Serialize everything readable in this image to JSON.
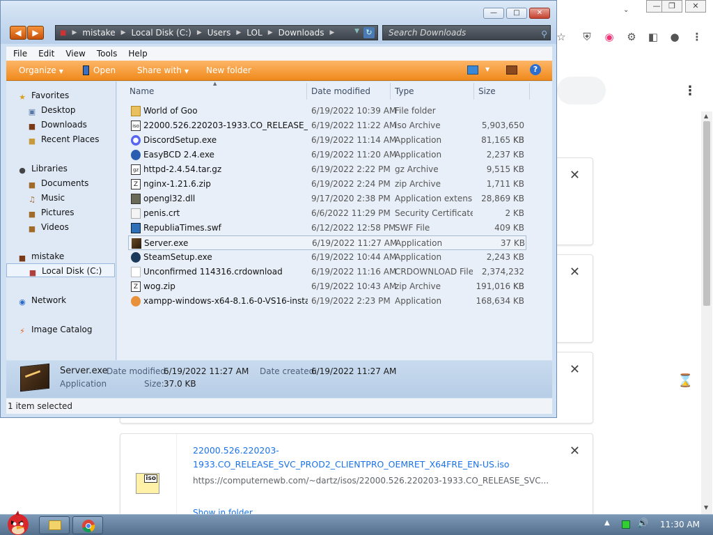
{
  "explorer": {
    "address": [
      "mistake",
      "Local Disk (C:)",
      "Users",
      "LOL",
      "Downloads"
    ],
    "search_placeholder": "Search Downloads",
    "menu": [
      "File",
      "Edit",
      "View",
      "Tools",
      "Help"
    ],
    "commands": {
      "organize": "Organize",
      "open": "Open",
      "share_with": "Share with",
      "new_folder": "New folder"
    },
    "nav": {
      "favorites": "Favorites",
      "favorites_items": [
        "Desktop",
        "Downloads",
        "Recent Places"
      ],
      "libraries": "Libraries",
      "libraries_items": [
        "Documents",
        "Music",
        "Pictures",
        "Videos"
      ],
      "computer": "mistake",
      "computer_items": [
        "Local Disk (C:)"
      ],
      "network": "Network",
      "image_catalog": "Image Catalog"
    },
    "columns": {
      "name": "Name",
      "date": "Date modified",
      "type": "Type",
      "size": "Size"
    },
    "files": [
      {
        "name": "World of Goo",
        "date": "6/19/2022 10:39 AM",
        "type": "File folder",
        "size": "",
        "icon": "folder-icon"
      },
      {
        "name": "22000.526.220203-1933.CO_RELEASE_SVC...",
        "date": "6/19/2022 11:22 AM",
        "type": "iso Archive",
        "size": "5,903,650 KB",
        "icon": "iso-icon"
      },
      {
        "name": "DiscordSetup.exe",
        "date": "6/19/2022 11:14 AM",
        "type": "Application",
        "size": "81,165 KB",
        "icon": "discord-icon"
      },
      {
        "name": "EasyBCD 2.4.exe",
        "date": "6/19/2022 11:20 AM",
        "type": "Application",
        "size": "2,237 KB",
        "icon": "app-icon"
      },
      {
        "name": "httpd-2.4.54.tar.gz",
        "date": "6/19/2022 2:22 PM",
        "type": "gz Archive",
        "size": "9,515 KB",
        "icon": "archive-icon"
      },
      {
        "name": "nginx-1.21.6.zip",
        "date": "6/19/2022 2:24 PM",
        "type": "zip Archive",
        "size": "1,711 KB",
        "icon": "zip-icon"
      },
      {
        "name": "opengl32.dll",
        "date": "9/17/2020 2:38 PM",
        "type": "Application extens...",
        "size": "28,869 KB",
        "icon": "dll-icon"
      },
      {
        "name": "penis.crt",
        "date": "6/6/2022 11:29 PM",
        "type": "Security Certificate",
        "size": "2 KB",
        "icon": "certificate-icon"
      },
      {
        "name": "RepubliaTimes.swf",
        "date": "6/12/2022 12:58 PM",
        "type": "SWF File",
        "size": "409 KB",
        "icon": "swf-icon"
      },
      {
        "name": "Server.exe",
        "date": "6/19/2022 11:27 AM",
        "type": "Application",
        "size": "37 KB",
        "icon": "server-exe-icon"
      },
      {
        "name": "SteamSetup.exe",
        "date": "6/19/2022 10:44 AM",
        "type": "Application",
        "size": "2,243 KB",
        "icon": "steam-icon"
      },
      {
        "name": "Unconfirmed 114316.crdownload",
        "date": "6/19/2022 11:16 AM",
        "type": "CRDOWNLOAD File",
        "size": "2,374,232 KB",
        "icon": "file-icon"
      },
      {
        "name": "wog.zip",
        "date": "6/19/2022 10:43 AM",
        "type": "zip Archive",
        "size": "191,016 KB",
        "icon": "zip-icon"
      },
      {
        "name": "xampp-windows-x64-8.1.6-0-VS16-install...",
        "date": "6/19/2022 2:23 PM",
        "type": "Application",
        "size": "168,634 KB",
        "icon": "xampp-icon"
      }
    ],
    "details": {
      "name": "Server.exe",
      "type": "Application",
      "date_modified_label": "Date modified:",
      "date_modified": "6/19/2022 11:27 AM",
      "date_created_label": "Date created:",
      "date_created": "6/19/2022 11:27 AM",
      "size_label": "Size:",
      "size": "37.0 KB"
    },
    "status": "1 item selected"
  },
  "chrome": {
    "download_card": {
      "filename": "22000.526.220203-1933.CO_RELEASE_SVC_PROD2_CLIENTPRO_OEMRET_X64FRE_EN-US.iso",
      "url": "https://computernewb.com/~dartz/isos/22000.526.220203-1933.CO_RELEASE_SVC...",
      "show_in_folder": "Show in folder",
      "icon_text": "iso"
    }
  },
  "taskbar": {
    "time": "11:30 AM"
  }
}
